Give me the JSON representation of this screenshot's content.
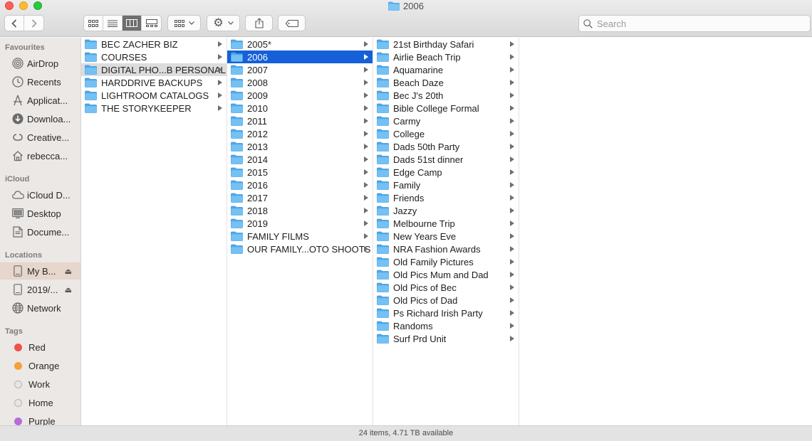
{
  "window": {
    "title": "2006"
  },
  "toolbar": {
    "view_modes": [
      "icon-view",
      "list-view",
      "column-view",
      "gallery-view"
    ],
    "active_view": "column-view",
    "search_placeholder": "Search"
  },
  "sidebar": {
    "sections": [
      {
        "title": "Favourites",
        "items": [
          {
            "label": "AirDrop",
            "icon": "airdrop-icon"
          },
          {
            "label": "Recents",
            "icon": "clock-icon"
          },
          {
            "label": "Applicat...",
            "icon": "applications-icon"
          },
          {
            "label": "Downloa...",
            "icon": "download-icon"
          },
          {
            "label": "Creative...",
            "icon": "creative-cloud-icon"
          },
          {
            "label": "rebecca...",
            "icon": "home-icon"
          }
        ]
      },
      {
        "title": "iCloud",
        "items": [
          {
            "label": "iCloud D...",
            "icon": "cloud-icon"
          },
          {
            "label": "Desktop",
            "icon": "desktop-icon"
          },
          {
            "label": "Docume...",
            "icon": "document-icon"
          }
        ]
      },
      {
        "title": "Locations",
        "items": [
          {
            "label": "My B...",
            "icon": "disk-icon",
            "selected": true,
            "eject": true
          },
          {
            "label": "2019/...",
            "icon": "disk-icon",
            "eject": true
          },
          {
            "label": "Network",
            "icon": "network-icon"
          }
        ]
      },
      {
        "title": "Tags",
        "items": [
          {
            "label": "Red",
            "color": "#f2504b"
          },
          {
            "label": "Orange",
            "color": "#f6a03b"
          },
          {
            "label": "Work",
            "color": "#e0e0e0"
          },
          {
            "label": "Home",
            "color": "#e0e0e0"
          },
          {
            "label": "Purple",
            "color": "#b86cd6"
          }
        ]
      }
    ]
  },
  "columns": [
    {
      "items": [
        {
          "name": "BEC ZACHER BIZ"
        },
        {
          "name": "COURSES"
        },
        {
          "name": "DIGITAL PHO...B PERSONAL",
          "selected": "inactive"
        },
        {
          "name": "HARDDRIVE BACKUPS"
        },
        {
          "name": "LIGHTROOM CATALOGS"
        },
        {
          "name": "THE STORYKEEPER"
        }
      ]
    },
    {
      "items": [
        {
          "name": "2005*"
        },
        {
          "name": "2006",
          "selected": "active"
        },
        {
          "name": "2007"
        },
        {
          "name": "2008"
        },
        {
          "name": "2009"
        },
        {
          "name": "2010"
        },
        {
          "name": "2011"
        },
        {
          "name": "2012"
        },
        {
          "name": "2013"
        },
        {
          "name": "2014"
        },
        {
          "name": "2015"
        },
        {
          "name": "2016"
        },
        {
          "name": "2017"
        },
        {
          "name": "2018"
        },
        {
          "name": "2019"
        },
        {
          "name": "FAMILY FILMS"
        },
        {
          "name": "OUR FAMILY...OTO SHOOTS"
        }
      ]
    },
    {
      "items": [
        {
          "name": "21st Birthday Safari"
        },
        {
          "name": "Airlie Beach Trip"
        },
        {
          "name": "Aquamarine"
        },
        {
          "name": "Beach Daze"
        },
        {
          "name": "Bec J's 20th"
        },
        {
          "name": "Bible College Formal"
        },
        {
          "name": "Carmy"
        },
        {
          "name": "College"
        },
        {
          "name": "Dads 50th Party"
        },
        {
          "name": "Dads 51st dinner"
        },
        {
          "name": "Edge Camp"
        },
        {
          "name": "Family"
        },
        {
          "name": "Friends"
        },
        {
          "name": "Jazzy"
        },
        {
          "name": "Melbourne Trip"
        },
        {
          "name": "New Years Eve"
        },
        {
          "name": "NRA Fashion Awards"
        },
        {
          "name": "Old Family Pictures"
        },
        {
          "name": "Old Pics Mum and Dad"
        },
        {
          "name": "Old Pics of Bec"
        },
        {
          "name": "Old Pics of Dad"
        },
        {
          "name": "Ps Richard Irish Party"
        },
        {
          "name": "Randoms"
        },
        {
          "name": "Surf Prd Unit"
        }
      ]
    }
  ],
  "status_bar": {
    "text": "24 items, 4.71 TB available"
  }
}
